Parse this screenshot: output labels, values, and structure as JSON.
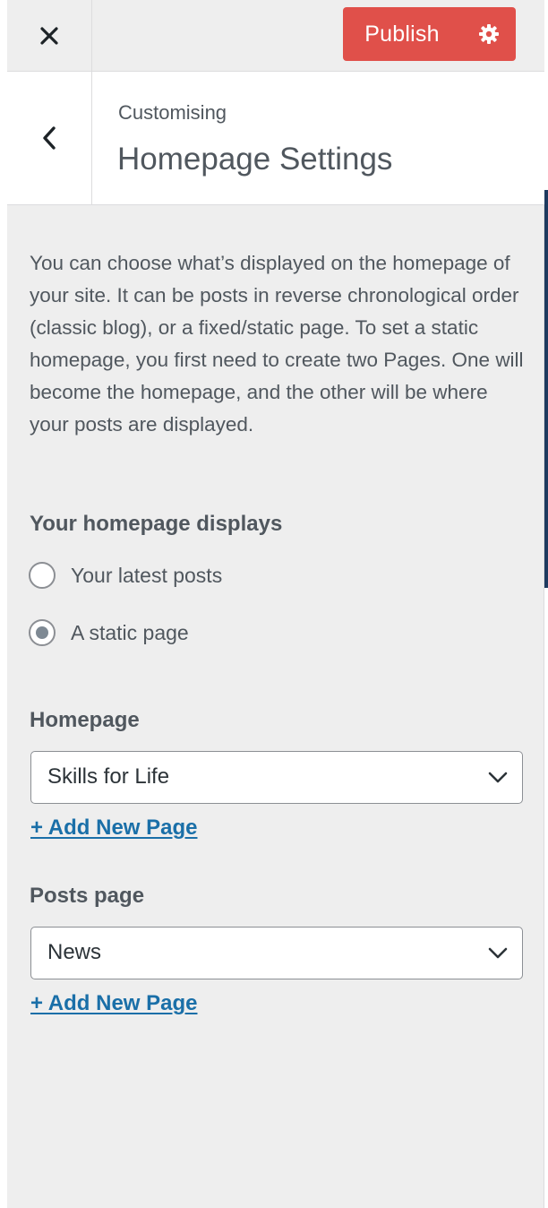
{
  "header": {
    "close_label": "Close",
    "publish_label": "Publish",
    "publish_color": "#e0504a"
  },
  "title": {
    "breadcrumb": "Customising",
    "section_title": "Homepage Settings"
  },
  "description": "You can choose what’s displayed on the homepage of your site. It can be posts in reverse chronological order (classic blog), or a fixed/static page. To set a static homepage, you first need to create two Pages. One will become the homepage, and the other will be where your posts are displayed.",
  "homepage_displays": {
    "label": "Your homepage displays",
    "options": [
      {
        "label": "Your latest posts",
        "checked": false
      },
      {
        "label": "A static page",
        "checked": true
      }
    ]
  },
  "homepage": {
    "label": "Homepage",
    "selected": "Skills for Life",
    "add_link": "+ Add New Page"
  },
  "posts_page": {
    "label": "Posts page",
    "selected": "News",
    "add_link": "+ Add New Page"
  },
  "icons": {
    "close": "close-icon",
    "settings": "gear-icon",
    "back": "chevron-left-icon",
    "dropdown": "chevron-down-icon"
  }
}
